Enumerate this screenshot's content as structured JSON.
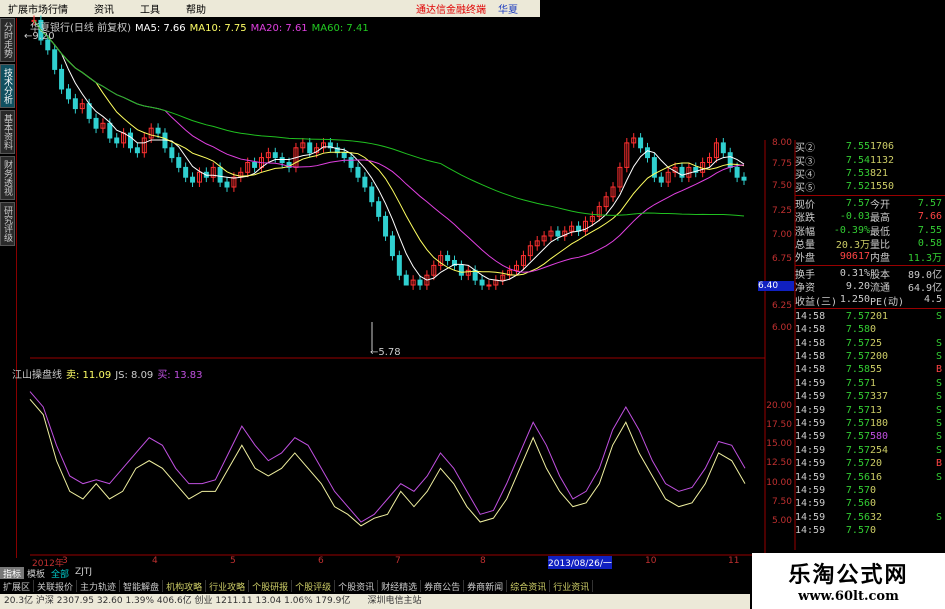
{
  "menu": {
    "items": [
      "扩展市场行情",
      "资讯",
      "工具",
      "帮助"
    ],
    "brand": "通达信金融终端",
    "brand2": "华夏"
  },
  "left_tabs": [
    "分时走势",
    "技术分析",
    "基本资料",
    "财务透视",
    "研究评级"
  ],
  "chart_title": {
    "name": "华夏银行(日线 前复权)",
    "ma5": "MA5: 7.66",
    "ma10": "MA10: 7.75",
    "ma20": "MA20: 7.61",
    "ma60": "MA60: 7.41"
  },
  "indicator_title": {
    "name": "江山操盘线",
    "sell": "卖: 11.09",
    "js": "JS: 8.09",
    "buy": "买: 13.83"
  },
  "annotations": {
    "high": "9.20",
    "low": "5.78"
  },
  "colors": {
    "up": "#ff3030",
    "down": "#30d0d0",
    "ma5": "#ffffff",
    "ma10": "#ffff60",
    "ma20": "#e040e0",
    "ma60": "#20c020",
    "ind_a": "#c050e0",
    "ind_b": "#f0f0a0"
  },
  "chart_data": [
    {
      "type": "candlestick",
      "price_axis": [
        "8.00",
        "7.75",
        "7.50",
        "7.25",
        "7.00",
        "6.75",
        "6.40",
        "6.25",
        "6.00"
      ],
      "current_price_box": "6.40",
      "closes": [
        9.2,
        9.0,
        8.9,
        8.7,
        8.5,
        8.4,
        8.3,
        8.35,
        8.2,
        8.1,
        8.15,
        8.0,
        7.95,
        8.05,
        7.9,
        7.85,
        8.0,
        8.1,
        8.05,
        7.9,
        7.8,
        7.7,
        7.6,
        7.55,
        7.65,
        7.6,
        7.7,
        7.55,
        7.5,
        7.6,
        7.65,
        7.75,
        7.7,
        7.8,
        7.85,
        7.8,
        7.75,
        7.7,
        7.9,
        7.95,
        7.85,
        7.9,
        7.95,
        7.9,
        7.85,
        7.8,
        7.7,
        7.6,
        7.5,
        7.35,
        7.2,
        7.0,
        6.8,
        6.6,
        6.5,
        6.55,
        6.5,
        6.6,
        6.7,
        6.8,
        6.75,
        6.7,
        6.6,
        6.65,
        6.55,
        6.5,
        6.5,
        6.55,
        6.6,
        6.65,
        6.7,
        6.8,
        6.9,
        6.95,
        7.0,
        7.05,
        7.0,
        7.05,
        7.1,
        7.05,
        7.15,
        7.2,
        7.3,
        7.4,
        7.5,
        7.7,
        7.95,
        8.0,
        7.9,
        7.8,
        7.6,
        7.55,
        7.65,
        7.7,
        7.6,
        7.7,
        7.65,
        7.75,
        7.8,
        7.95,
        7.85,
        7.7,
        7.6,
        7.57
      ]
    },
    {
      "type": "line",
      "price_axis": [
        "20.00",
        "17.50",
        "15.00",
        "12.50",
        "10.00",
        "7.50",
        "5.00"
      ],
      "series": [
        {
          "values": [
            22,
            20,
            15,
            11,
            10,
            10.5,
            10,
            12,
            14,
            16,
            15,
            12,
            10,
            10,
            10.5,
            14,
            17.5,
            15,
            13,
            14,
            16,
            15,
            12,
            9,
            7,
            5,
            6,
            8,
            10,
            9,
            11,
            14,
            12,
            9,
            6,
            6.5,
            10,
            14,
            18,
            15,
            11,
            8,
            9,
            12,
            17,
            20,
            17,
            13,
            10,
            9,
            9.5,
            12,
            15.5,
            15,
            12
          ]
        },
        {
          "values": [
            21,
            19,
            13,
            9,
            8,
            10,
            8,
            9,
            12,
            13,
            12,
            10,
            8,
            9,
            9,
            12,
            15,
            12,
            11,
            12,
            14,
            12,
            10,
            7,
            6,
            4.5,
            5.5,
            6,
            9,
            7,
            9,
            12,
            10,
            7,
            5,
            5.5,
            8,
            12,
            16,
            12,
            9,
            7,
            7.5,
            10,
            15,
            18,
            14,
            11,
            8,
            7,
            7.5,
            10,
            14,
            13,
            10
          ]
        }
      ]
    },
    {
      "type": "date_axis",
      "labels": [
        "2012年",
        "3",
        "4",
        "5",
        "6",
        "7",
        "8",
        "2013/08/26/一",
        "10",
        "11"
      ]
    }
  ],
  "quote": {
    "bids": [
      [
        "买②",
        "7.55",
        "1706"
      ],
      [
        "买③",
        "7.54",
        "1132"
      ],
      [
        "买④",
        "7.53",
        "821"
      ],
      [
        "买⑤",
        "7.52",
        "1550"
      ]
    ],
    "stats": [
      [
        "现价",
        "7.57",
        "今开",
        "7.57"
      ],
      [
        "涨跌",
        "-0.03",
        "最高",
        "7.66"
      ],
      [
        "涨幅",
        "-0.39%",
        "最低",
        "7.55"
      ],
      [
        "总量",
        "20.3万",
        "量比",
        "0.58"
      ],
      [
        "外盘",
        "90617",
        "内盘",
        "11.3万"
      ]
    ],
    "stats2": [
      [
        "换手",
        "0.31%",
        "股本",
        "89.0亿"
      ],
      [
        "净资",
        "9.20",
        "流通",
        "64.9亿"
      ],
      [
        "收益(三)",
        "1.250",
        "PE(动)",
        "4.5"
      ]
    ],
    "ticks": [
      [
        "14:58",
        "7.57",
        "201",
        "S"
      ],
      [
        "14:58",
        "7.58",
        "0",
        ""
      ],
      [
        "14:58",
        "7.57",
        "25",
        "S"
      ],
      [
        "14:58",
        "7.57",
        "200",
        "S"
      ],
      [
        "14:58",
        "7.58",
        "55",
        "B"
      ],
      [
        "14:59",
        "7.57",
        "1",
        "S"
      ],
      [
        "14:59",
        "7.57",
        "337",
        "S"
      ],
      [
        "14:59",
        "7.57",
        "13",
        "S"
      ],
      [
        "14:59",
        "7.57",
        "180",
        "S"
      ],
      [
        "14:59",
        "7.57",
        "580",
        "S"
      ],
      [
        "14:59",
        "7.57",
        "254",
        "S"
      ],
      [
        "14:59",
        "7.57",
        "20",
        "B"
      ],
      [
        "14:59",
        "7.56",
        "16",
        "S"
      ],
      [
        "14:59",
        "7.57",
        "0",
        ""
      ],
      [
        "14:59",
        "7.56",
        "0",
        ""
      ],
      [
        "14:59",
        "7.56",
        "32",
        "S"
      ],
      [
        "14:59",
        "7.57",
        "0",
        ""
      ]
    ]
  },
  "tabs": [
    "指标",
    "模板",
    "全部",
    "ZJTJ"
  ],
  "bottom_buttons": [
    "扩展区",
    "关联报价",
    "主力轨迹",
    "智能解盘",
    "机构攻略",
    "行业攻略",
    "个股研报",
    "个股评级",
    "个股资讯",
    "财经精选",
    "券商公告",
    "券商新闻",
    "综合资讯",
    "行业资讯"
  ],
  "status_text": "20.3亿 沪深 2307.95  32.60  1.39%  406.6亿 创业 1211.11  13.04  1.06%  179.9亿",
  "status_right": "深圳电信主站",
  "watermark": {
    "title": "乐淘公式网",
    "url": "www.60lt.com"
  }
}
